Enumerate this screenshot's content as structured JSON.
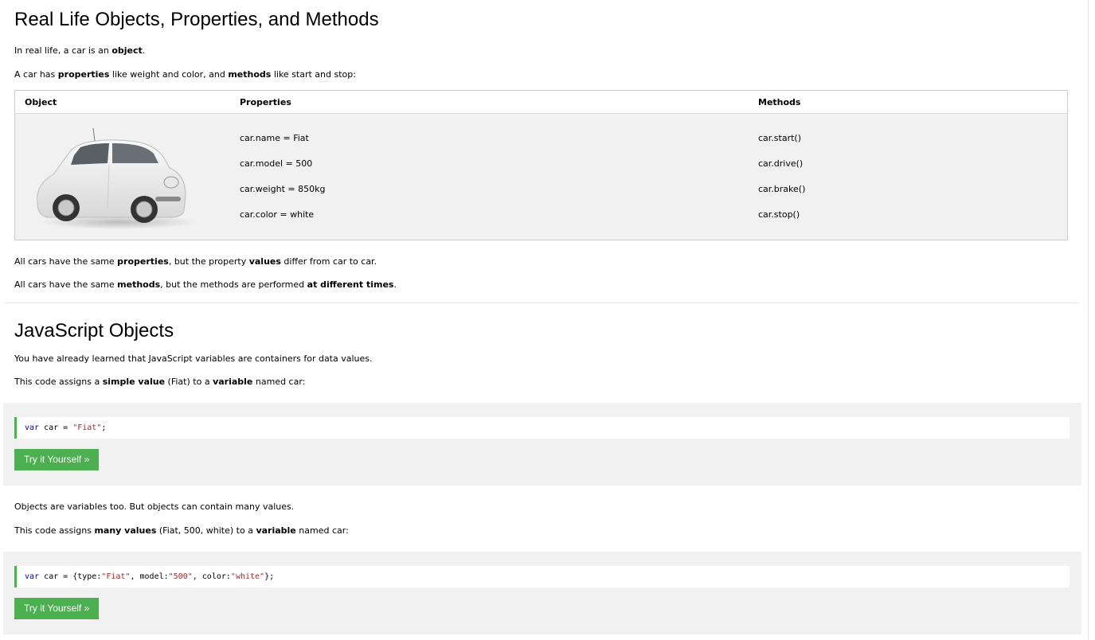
{
  "section1": {
    "title": "Real Life Objects, Properties, and Methods",
    "p1": {
      "pre": "In real life, a car is an ",
      "b1": "object",
      "post": "."
    },
    "p2": {
      "pre": "A car has ",
      "b1": "properties",
      "mid": " like weight and color, and ",
      "b2": "methods",
      "post": " like start and stop:"
    },
    "table": {
      "headers": [
        "Object",
        "Properties",
        "Methods"
      ],
      "properties": [
        "car.name = Fiat",
        "car.model = 500",
        "car.weight = 850kg",
        "car.color = white"
      ],
      "methods": [
        "car.start()",
        "car.drive()",
        "car.brake()",
        "car.stop()"
      ]
    },
    "p3": {
      "pre": "All cars have the same ",
      "b1": "properties",
      "mid": ", but the property ",
      "b2": "values",
      "post": " differ from car to car."
    },
    "p4": {
      "pre": "All cars have the same ",
      "b1": "methods",
      "mid": ", but the methods are performed ",
      "b2": "at different times",
      "post": "."
    }
  },
  "section2": {
    "title": "JavaScript Objects",
    "p5": "You have already learned that JavaScript variables are containers for data values.",
    "p6": {
      "pre": "This code assigns a ",
      "b1": "simple value",
      "mid": " (Fiat) to a ",
      "b2": "variable",
      "post": " named car:"
    },
    "example1": {
      "kw": "var",
      "code_mid": " car = ",
      "str": "\"Fiat\"",
      "code_end": ";",
      "button": "Try it Yourself »"
    },
    "p7": "Objects are variables too. But objects can contain many values.",
    "p8": {
      "pre": "This code assigns ",
      "b1": "many values",
      "mid": " (Fiat, 500, white) to a ",
      "b2": "variable",
      "post": " named car:"
    },
    "example2": {
      "kw": "var",
      "c1": " car = {type:",
      "s1": "\"Fiat\"",
      "c2": ", model:",
      "s2": "\"500\"",
      "c3": ", color:",
      "s3": "\"white\"",
      "c4": "};",
      "button": "Try it Yourself »"
    }
  },
  "colors": {
    "accent": "#4caf50",
    "panel": "#f1f1f1",
    "keyword": "#0000cd",
    "string": "#a52a2a"
  }
}
